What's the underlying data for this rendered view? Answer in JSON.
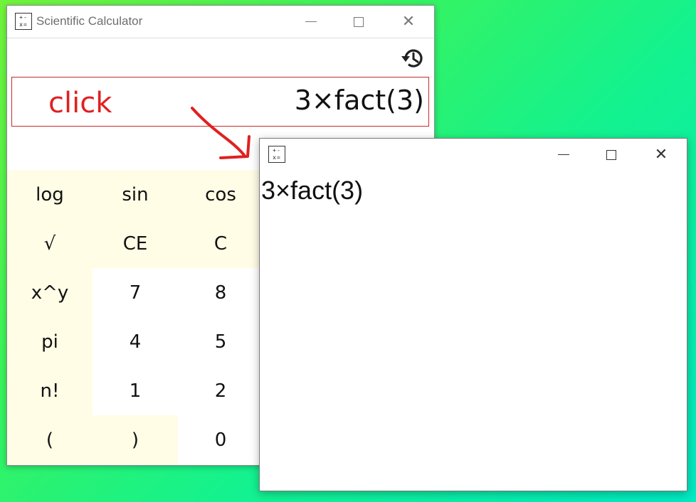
{
  "calculator": {
    "title": "Scientific Calculator",
    "app_icon_top": "+-",
    "app_icon_bottom": "x=",
    "display_expression": "3×fact(3)",
    "history_icon": "history-icon",
    "keys": [
      {
        "label": "log",
        "type": "func"
      },
      {
        "label": "sin",
        "type": "func"
      },
      {
        "label": "cos",
        "type": "func"
      },
      {
        "label": "√",
        "type": "func"
      },
      {
        "label": "CE",
        "type": "func"
      },
      {
        "label": "C",
        "type": "func"
      },
      {
        "label": "x^y",
        "type": "func"
      },
      {
        "label": "7",
        "type": "num"
      },
      {
        "label": "8",
        "type": "num"
      },
      {
        "label": "pi",
        "type": "func"
      },
      {
        "label": "4",
        "type": "num"
      },
      {
        "label": "5",
        "type": "num"
      },
      {
        "label": "n!",
        "type": "func"
      },
      {
        "label": "1",
        "type": "num"
      },
      {
        "label": "2",
        "type": "num"
      },
      {
        "label": "(",
        "type": "func"
      },
      {
        "label": ")",
        "type": "func"
      },
      {
        "label": "0",
        "type": "num"
      }
    ]
  },
  "annotation": {
    "label": "click",
    "color": "#e02020"
  },
  "popup": {
    "app_icon_top": "+-",
    "app_icon_bottom": "x=",
    "expression": "3×fact(3)"
  },
  "window_controls": {
    "minimize_icon": "minimize-icon",
    "maximize_icon": "maximize-icon",
    "close_icon": "close-icon",
    "close_glyph": "✕"
  }
}
